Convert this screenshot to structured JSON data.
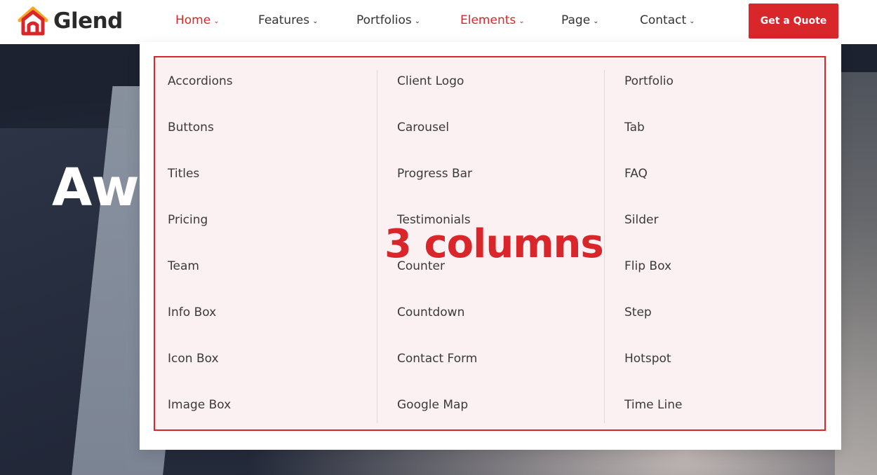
{
  "header": {
    "logo_text": "Glend",
    "nav": [
      {
        "label": "Home",
        "active": true
      },
      {
        "label": "Features",
        "active": false
      },
      {
        "label": "Portfolios",
        "active": false
      },
      {
        "label": "Elements",
        "active": true
      },
      {
        "label": "Page",
        "active": false
      },
      {
        "label": "Contact",
        "active": false
      }
    ],
    "cta_label": "Get a Quote",
    "caret_icon": "chevron-down-icon"
  },
  "hero": {
    "title_partial": "Awe"
  },
  "mega_menu": {
    "columns": [
      [
        "Accordions",
        "Buttons",
        "Titles",
        "Pricing",
        "Team",
        "Info Box",
        "Icon Box",
        "Image Box"
      ],
      [
        "Client Logo",
        "Carousel",
        "Progress Bar",
        "Testimonials",
        "Counter",
        "Countdown",
        "Contact Form",
        "Google Map"
      ],
      [
        "Portfolio",
        "Tab",
        "FAQ",
        "Silder",
        "Flip Box",
        "Step",
        "Hotspot",
        "Time Line"
      ]
    ],
    "annotation": "3 columns"
  },
  "colors": {
    "accent": "#d8262b",
    "menu_bg": "#fcf1f2",
    "text": "#3a3a3a",
    "logo_orange": "#f5a623"
  }
}
